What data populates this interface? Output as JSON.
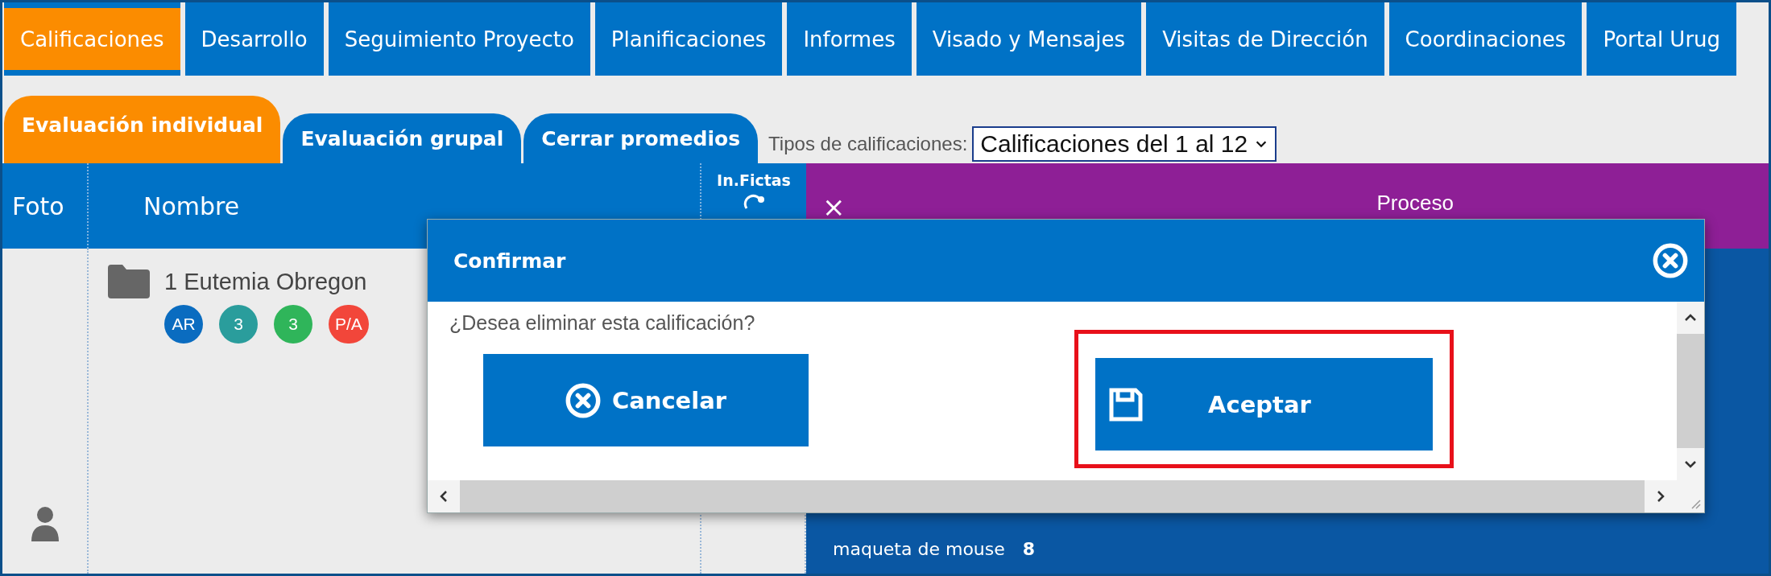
{
  "nav_tabs": [
    {
      "label": "Calificaciones",
      "selected": true
    },
    {
      "label": "Desarrollo",
      "selected": false
    },
    {
      "label": "Seguimiento Proyecto",
      "selected": false
    },
    {
      "label": "Planificaciones",
      "selected": false
    },
    {
      "label": "Informes",
      "selected": false
    },
    {
      "label": "Visado y Mensajes",
      "selected": false
    },
    {
      "label": "Visitas de Dirección",
      "selected": false
    },
    {
      "label": "Coordinaciones",
      "selected": false
    },
    {
      "label": "Portal Urug",
      "selected": false
    }
  ],
  "sub_tabs": [
    {
      "label": "Evaluación individual",
      "selected": true
    },
    {
      "label": "Evaluación grupal",
      "selected": false
    },
    {
      "label": "Cerrar promedios",
      "selected": false
    }
  ],
  "grade_type": {
    "label": "Tipos de calificaciones:",
    "value": "Calificaciones del 1 al 12"
  },
  "table": {
    "columns": [
      "Foto",
      "Nombre",
      "In.Fictas"
    ],
    "group_header": {
      "close": "×",
      "title": "Proceso"
    },
    "rows": [
      {
        "name": "1 Eutemia Obregon",
        "badges": [
          {
            "text": "AR",
            "color": "#0a6cc0"
          },
          {
            "text": "3",
            "color": "#2a9d9c"
          },
          {
            "text": "3",
            "color": "#2fb55a"
          },
          {
            "text": "P/A",
            "color": "#f2463a"
          }
        ]
      }
    ]
  },
  "grade_panel": {
    "item": "maqueta de mouse",
    "score": "8"
  },
  "dialog": {
    "title": "Confirmar",
    "message": "¿Desea eliminar esta calificación?",
    "buttons": [
      {
        "label": "Cancelar",
        "kind": "cancel",
        "highlighted": false
      },
      {
        "label": "Aceptar",
        "kind": "save",
        "highlighted": true
      }
    ]
  }
}
